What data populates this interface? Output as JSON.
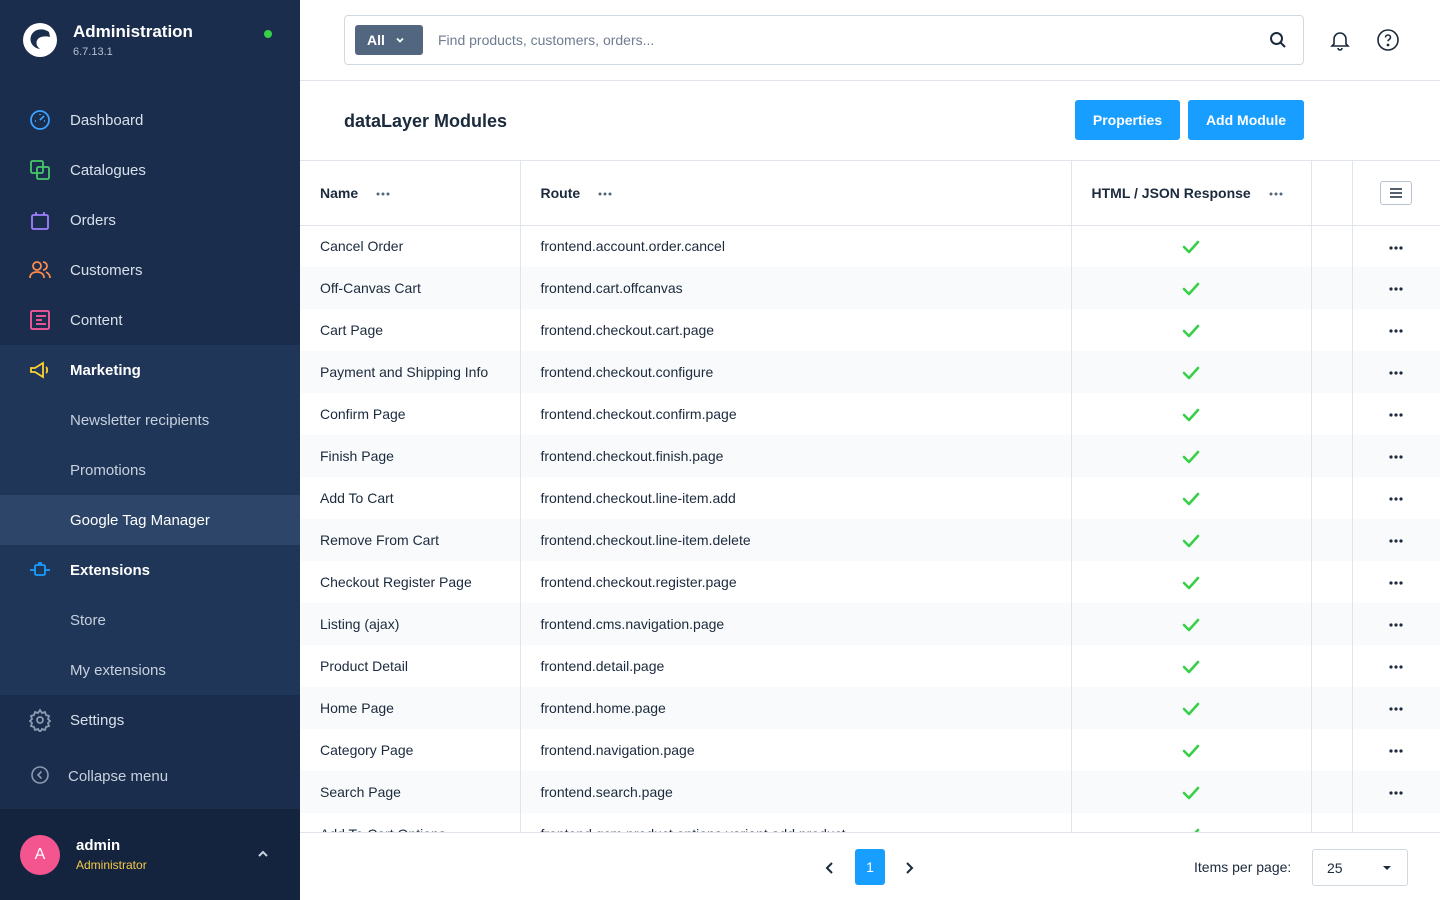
{
  "app": {
    "title": "Administration",
    "version": "6.7.13.1",
    "status_color": "#37d046"
  },
  "sidebar": {
    "items": [
      {
        "label": "Dashboard",
        "icon": "gauge-icon",
        "color": "#3aa1ff"
      },
      {
        "label": "Catalogues",
        "icon": "catalogue-icon",
        "color": "#46c96a"
      },
      {
        "label": "Orders",
        "icon": "shopping-bag-icon",
        "color": "#a080ff"
      },
      {
        "label": "Customers",
        "icon": "users-icon",
        "color": "#ff8a4c"
      },
      {
        "label": "Content",
        "icon": "content-icon",
        "color": "#ff5a9c"
      }
    ],
    "marketing": {
      "label": "Marketing",
      "icon": "megaphone-icon",
      "color": "#ffd02f",
      "children": [
        "Newsletter recipients",
        "Promotions",
        "Google Tag Manager"
      ],
      "active": "Google Tag Manager"
    },
    "extensions": {
      "label": "Extensions",
      "icon": "plug-icon",
      "color": "#189eff",
      "children": [
        "Store",
        "My extensions"
      ]
    },
    "settings": {
      "label": "Settings",
      "icon": "gear-icon"
    },
    "collapse": {
      "label": "Collapse menu",
      "icon": "chevron-left-circle-icon"
    }
  },
  "user": {
    "initial": "A",
    "name": "admin",
    "role": "Administrator",
    "avatar_color": "#f5558f"
  },
  "search": {
    "type_label": "All",
    "placeholder": "Find products, customers, orders..."
  },
  "page": {
    "title": "dataLayer Modules",
    "btn_properties": "Properties",
    "btn_add": "Add Module"
  },
  "table": {
    "columns": [
      "Name",
      "Route",
      "HTML / JSON Response"
    ],
    "rows": [
      {
        "name": "Cancel Order",
        "route": "frontend.account.order.cancel",
        "response": true
      },
      {
        "name": "Off-Canvas Cart",
        "route": "frontend.cart.offcanvas",
        "response": true
      },
      {
        "name": "Cart Page",
        "route": "frontend.checkout.cart.page",
        "response": true
      },
      {
        "name": "Payment and Shipping Info",
        "route": "frontend.checkout.configure",
        "response": true
      },
      {
        "name": "Confirm Page",
        "route": "frontend.checkout.confirm.page",
        "response": true
      },
      {
        "name": "Finish Page",
        "route": "frontend.checkout.finish.page",
        "response": true
      },
      {
        "name": "Add To Cart",
        "route": "frontend.checkout.line-item.add",
        "response": true
      },
      {
        "name": "Remove From Cart",
        "route": "frontend.checkout.line-item.delete",
        "response": true
      },
      {
        "name": "Checkout Register Page",
        "route": "frontend.checkout.register.page",
        "response": true
      },
      {
        "name": "Listing (ajax)",
        "route": "frontend.cms.navigation.page",
        "response": true
      },
      {
        "name": "Product Detail",
        "route": "frontend.detail.page",
        "response": true
      },
      {
        "name": "Home Page",
        "route": "frontend.home.page",
        "response": true
      },
      {
        "name": "Category Page",
        "route": "frontend.navigation.page",
        "response": true
      },
      {
        "name": "Search Page",
        "route": "frontend.search.page",
        "response": true
      },
      {
        "name": "Add To Cart Options",
        "route": "frontend.gcm.product.options.variant.add.product",
        "response": true
      }
    ],
    "check_color": "#37d046"
  },
  "pagination": {
    "current_page": "1",
    "items_per_page_label": "Items per page:",
    "items_per_page": "25"
  }
}
